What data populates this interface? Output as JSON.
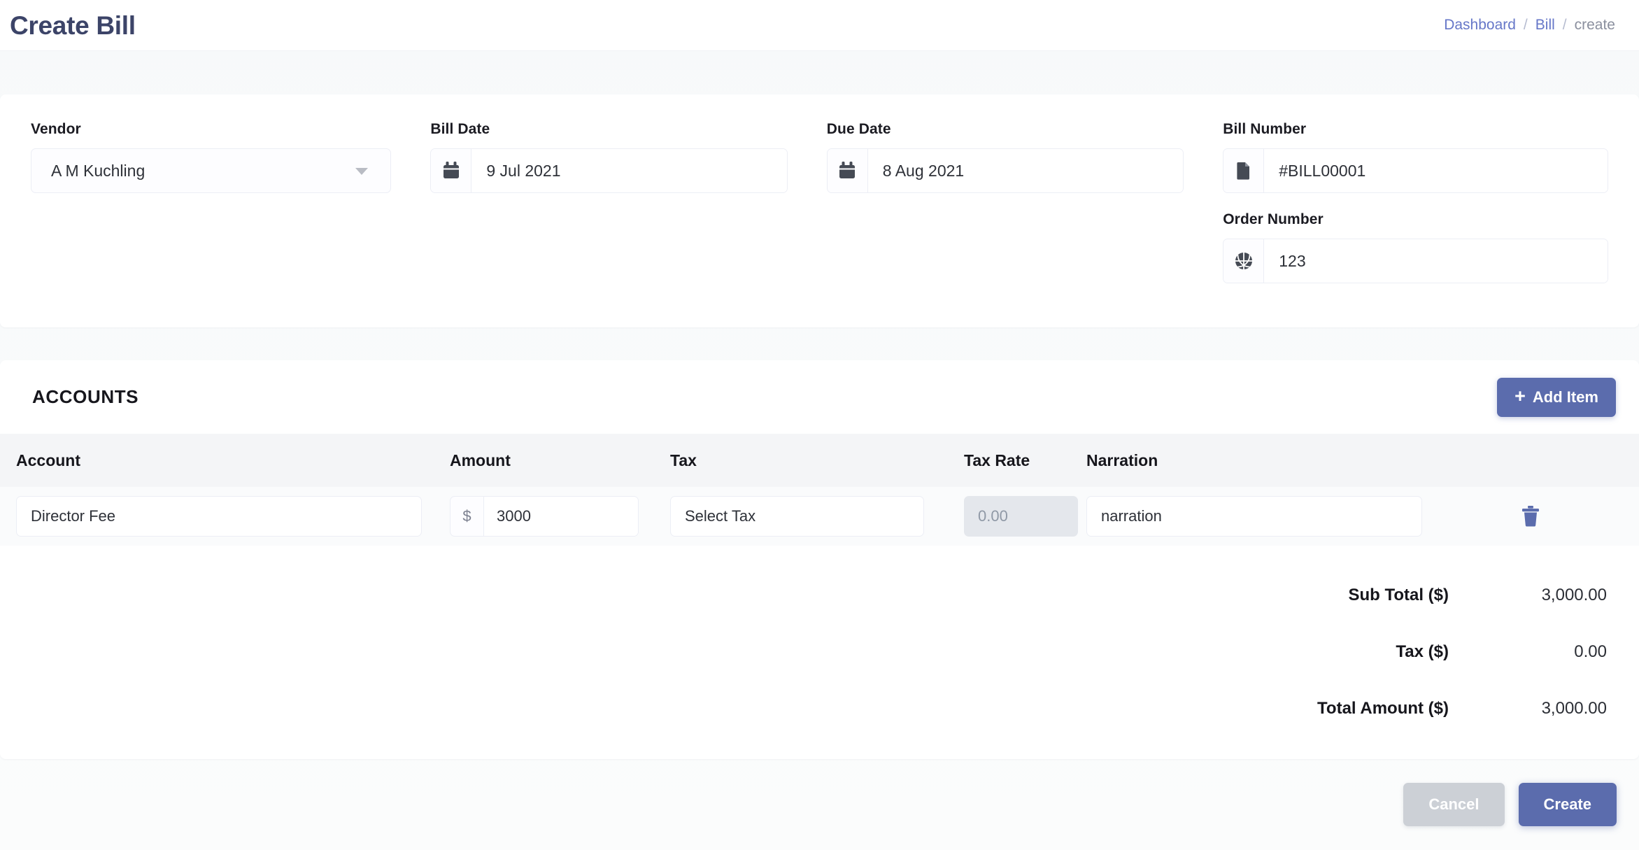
{
  "header": {
    "title": "Create Bill",
    "breadcrumb": [
      {
        "label": "Dashboard",
        "type": "link"
      },
      {
        "label": "/",
        "type": "sep"
      },
      {
        "label": "Bill",
        "type": "link"
      },
      {
        "label": "/",
        "type": "sep"
      },
      {
        "label": "create",
        "type": "current"
      }
    ]
  },
  "form": {
    "vendor": {
      "label": "Vendor",
      "value": "A M Kuchling",
      "icon": "chevron-down-icon"
    },
    "bill_date": {
      "label": "Bill Date",
      "value": "9 Jul 2021",
      "icon": "calendar-icon"
    },
    "due_date": {
      "label": "Due Date",
      "value": "8 Aug 2021",
      "icon": "calendar-icon"
    },
    "bill_number": {
      "label": "Bill Number",
      "value": "#BILL00001",
      "icon": "document-icon"
    },
    "order_number": {
      "label": "Order Number",
      "value": "123",
      "icon": "basketball-icon"
    }
  },
  "accounts": {
    "section_title": "ACCOUNTS",
    "add_item_label": "Add Item",
    "add_item_icon": "plus-icon",
    "columns": [
      "Account",
      "Amount",
      "Tax",
      "Tax Rate",
      "Narration"
    ],
    "rows": [
      {
        "account": "Director Fee",
        "currency_symbol": "$",
        "amount": "3000",
        "tax": "Select Tax",
        "tax_rate": "0.00",
        "narration": "narration",
        "delete_icon": "trash-icon"
      }
    ],
    "totals": [
      {
        "label": "Sub Total ($)",
        "value": "3,000.00"
      },
      {
        "label": "Tax ($)",
        "value": "0.00"
      },
      {
        "label": "Total Amount ($)",
        "value": "3,000.00"
      }
    ]
  },
  "footer": {
    "cancel_label": "Cancel",
    "create_label": "Create"
  },
  "colors": {
    "title": "#3c4468",
    "accent": "#5b6cad",
    "breadcrumb_link": "#6677c8",
    "breadcrumb_current": "#8a8f9e",
    "cancel_bg": "#ccd0d6",
    "table_header_bg": "#f4f5f7",
    "disabled_bg": "#e4e7ec",
    "page_bg": "#fafbfc"
  }
}
